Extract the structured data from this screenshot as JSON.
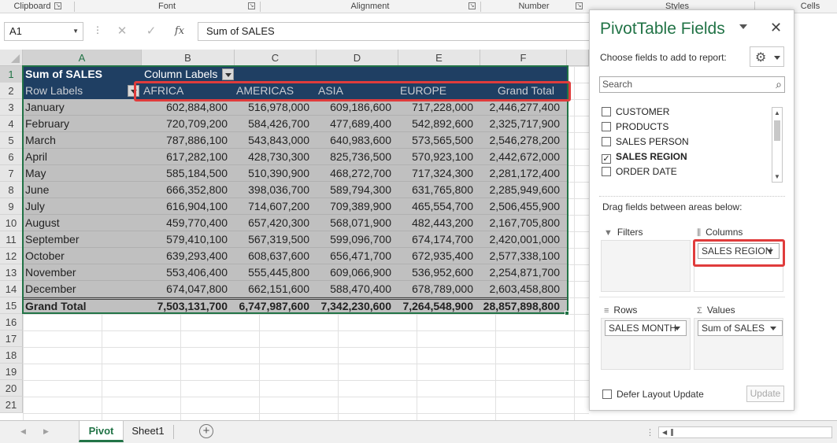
{
  "ribbon": {
    "groups": [
      "Clipboard",
      "Font",
      "Alignment",
      "Number",
      "Styles",
      "Cells"
    ]
  },
  "formula_bar": {
    "name_box": "A1",
    "cancel_glyph": "✕",
    "enter_glyph": "✓",
    "fx_glyph": "fx",
    "content": "Sum of SALES"
  },
  "grid": {
    "columns": [
      "A",
      "B",
      "C",
      "D",
      "E",
      "F"
    ],
    "rows": [
      "1",
      "2",
      "3",
      "4",
      "5",
      "6",
      "7",
      "8",
      "9",
      "10",
      "11",
      "12",
      "13",
      "14",
      "15",
      "16",
      "17",
      "18",
      "19",
      "20",
      "21"
    ],
    "values_label": "Sum of SALES",
    "column_labels": "Column Labels",
    "row_labels": "Row Labels",
    "regions": [
      "AFRICA",
      "AMERICAS",
      "ASIA",
      "EUROPE",
      "Grand Total"
    ],
    "data": [
      {
        "label": "January",
        "values": [
          "602,884,800",
          "516,978,000",
          "609,186,600",
          "717,228,000",
          "2,446,277,400"
        ]
      },
      {
        "label": "February",
        "values": [
          "720,709,200",
          "584,426,700",
          "477,689,400",
          "542,892,600",
          "2,325,717,900"
        ]
      },
      {
        "label": "March",
        "values": [
          "787,886,100",
          "543,843,000",
          "640,983,600",
          "573,565,500",
          "2,546,278,200"
        ]
      },
      {
        "label": "April",
        "values": [
          "617,282,100",
          "428,730,300",
          "825,736,500",
          "570,923,100",
          "2,442,672,000"
        ]
      },
      {
        "label": "May",
        "values": [
          "585,184,500",
          "510,390,900",
          "468,272,700",
          "717,324,300",
          "2,281,172,400"
        ]
      },
      {
        "label": "June",
        "values": [
          "666,352,800",
          "398,036,700",
          "589,794,300",
          "631,765,800",
          "2,285,949,600"
        ]
      },
      {
        "label": "July",
        "values": [
          "616,904,100",
          "714,607,200",
          "709,389,900",
          "465,554,700",
          "2,506,455,900"
        ]
      },
      {
        "label": "August",
        "values": [
          "459,770,400",
          "657,420,300",
          "568,071,900",
          "482,443,200",
          "2,167,705,800"
        ]
      },
      {
        "label": "September",
        "values": [
          "579,410,100",
          "567,319,500",
          "599,096,700",
          "674,174,700",
          "2,420,001,000"
        ]
      },
      {
        "label": "October",
        "values": [
          "639,293,400",
          "608,637,600",
          "656,471,700",
          "672,935,400",
          "2,577,338,100"
        ]
      },
      {
        "label": "November",
        "values": [
          "553,406,400",
          "555,445,800",
          "609,066,900",
          "536,952,600",
          "2,254,871,700"
        ]
      },
      {
        "label": "December",
        "values": [
          "674,047,800",
          "662,151,600",
          "588,470,400",
          "678,789,000",
          "2,603,458,800"
        ]
      }
    ],
    "grand_total": {
      "label": "Grand Total",
      "values": [
        "7,503,131,700",
        "6,747,987,600",
        "7,342,230,600",
        "7,264,548,900",
        "28,857,898,800"
      ]
    }
  },
  "sheet_tabs": {
    "tabs": [
      "Pivot",
      "Sheet1"
    ],
    "active": "Pivot",
    "add_glyph": "+"
  },
  "pivot_pane": {
    "title": "PivotTable Fields",
    "close_glyph": "✕",
    "choose_text": "Choose fields to add to report:",
    "search_placeholder": "Search",
    "fields": [
      {
        "name": "CUSTOMER",
        "checked": false
      },
      {
        "name": "PRODUCTS",
        "checked": false
      },
      {
        "name": "SALES PERSON",
        "checked": false
      },
      {
        "name": "SALES REGION",
        "checked": true
      },
      {
        "name": "ORDER DATE",
        "checked": false
      }
    ],
    "drag_text": "Drag fields between areas below:",
    "areas": {
      "filters": {
        "label": "Filters",
        "chips": []
      },
      "columns": {
        "label": "Columns",
        "chips": [
          "SALES REGION"
        ]
      },
      "rows": {
        "label": "Rows",
        "chips": [
          "SALES MONTH"
        ]
      },
      "values": {
        "label": "Values",
        "chips": [
          "Sum of SALES"
        ]
      }
    },
    "defer_label": "Defer Layout Update",
    "update_label": "Update"
  },
  "colors": {
    "excel_green": "#217346",
    "pivot_header": "#1f3f63",
    "pivot_body": "#c0c0c0",
    "highlight_red": "#e03c3c"
  }
}
